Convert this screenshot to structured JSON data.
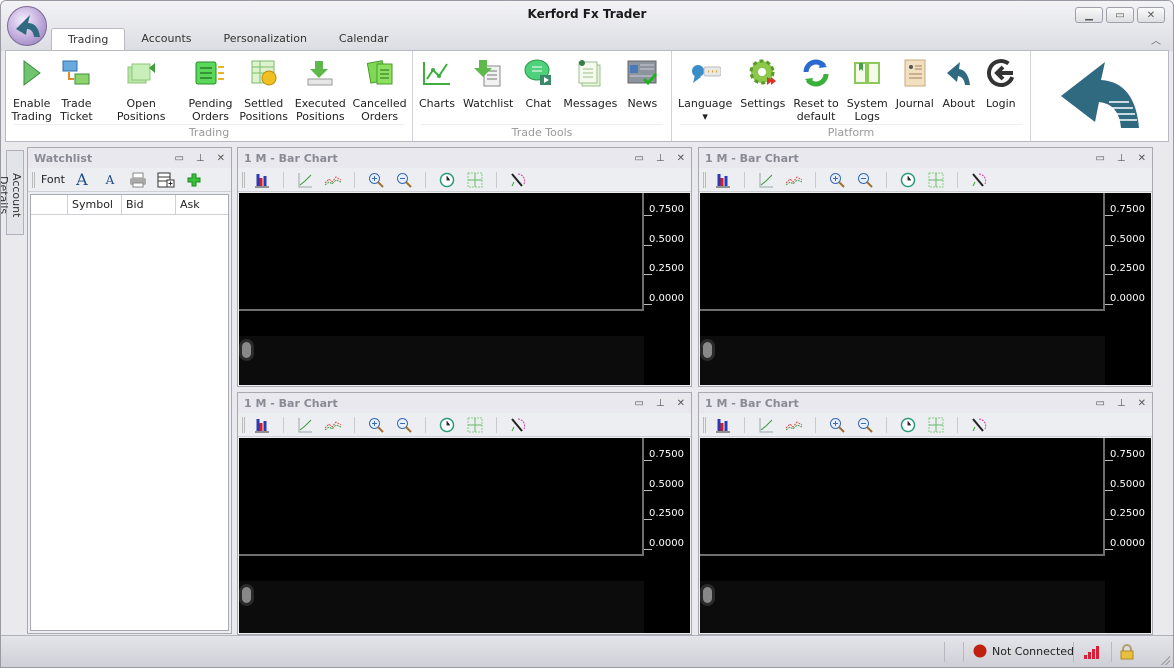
{
  "window": {
    "title": "Kerford Fx Trader",
    "controls": {
      "minimize": "minimize-icon",
      "maximize": "maximize-icon",
      "close": "close-icon"
    }
  },
  "tabs": [
    {
      "label": "Trading",
      "active": true
    },
    {
      "label": "Accounts",
      "active": false
    },
    {
      "label": "Personalization",
      "active": false
    },
    {
      "label": "Calendar",
      "active": false
    }
  ],
  "ribbon": {
    "groups": [
      {
        "label": "Trading",
        "buttons": [
          {
            "label": "Enable\nTrading",
            "l1": "Enable",
            "l2": "Trading",
            "icon": "play-icon"
          },
          {
            "label": "Trade Ticket",
            "l1": "Trade",
            "l2": "Ticket",
            "icon": "trade-ticket-icon"
          },
          {
            "label": "Open Positions",
            "l1": "Open Positions",
            "l2": "",
            "icon": "open-positions-icon"
          },
          {
            "label": "Pending Orders",
            "l1": "Pending",
            "l2": "Orders",
            "icon": "pending-orders-icon"
          },
          {
            "label": "Settled Positions",
            "l1": "Settled",
            "l2": "Positions",
            "icon": "settled-positions-icon"
          },
          {
            "label": "Executed Positions",
            "l1": "Executed",
            "l2": "Positions",
            "icon": "executed-positions-icon"
          },
          {
            "label": "Cancelled Orders",
            "l1": "Cancelled",
            "l2": "Orders",
            "icon": "cancelled-orders-icon"
          }
        ]
      },
      {
        "label": "Trade Tools",
        "buttons": [
          {
            "l1": "Charts",
            "l2": "",
            "icon": "chart-line-icon"
          },
          {
            "l1": "Watchlist",
            "l2": "",
            "icon": "watchlist-icon"
          },
          {
            "l1": "Chat",
            "l2": "",
            "icon": "chat-icon"
          },
          {
            "l1": "Messages",
            "l2": "",
            "icon": "messages-icon"
          },
          {
            "l1": "News",
            "l2": "",
            "icon": "news-icon"
          }
        ]
      },
      {
        "label": "Platform",
        "buttons": [
          {
            "l1": "Language",
            "l2": "▾",
            "icon": "language-icon"
          },
          {
            "l1": "Settings",
            "l2": "",
            "icon": "gear-icon"
          },
          {
            "l1": "Reset to",
            "l2": "default",
            "icon": "refresh-icon"
          },
          {
            "l1": "System",
            "l2": "Logs",
            "icon": "book-icon"
          },
          {
            "l1": "Journal",
            "l2": "",
            "icon": "journal-icon"
          },
          {
            "l1": "About",
            "l2": "",
            "icon": "logo-icon"
          },
          {
            "l1": "Login",
            "l2": "",
            "icon": "login-icon"
          }
        ]
      }
    ]
  },
  "side_tab": {
    "label": "Account Details"
  },
  "watchlist": {
    "title": "Watchlist",
    "toolbar": {
      "font_label": "Font"
    },
    "columns": [
      "",
      "Symbol",
      "Bid",
      "Ask"
    ],
    "rows": []
  },
  "charts": [
    {
      "title": "1 M - Bar Chart",
      "y_ticks": [
        "0.7500",
        "0.5000",
        "0.2500",
        "0.0000"
      ]
    },
    {
      "title": "1 M - Bar Chart",
      "y_ticks": [
        "0.7500",
        "0.5000",
        "0.2500",
        "0.0000"
      ]
    },
    {
      "title": "1 M - Bar Chart",
      "y_ticks": [
        "0.7500",
        "0.5000",
        "0.2500",
        "0.0000"
      ]
    },
    {
      "title": "1 M - Bar Chart",
      "y_ticks": [
        "0.7500",
        "0.5000",
        "0.2500",
        "0.0000"
      ]
    }
  ],
  "status": {
    "connection": "Not Connected",
    "connection_color": "#c0200f",
    "signal_color": "#d8203a"
  },
  "colors": {
    "brand": "#2f6a80"
  }
}
